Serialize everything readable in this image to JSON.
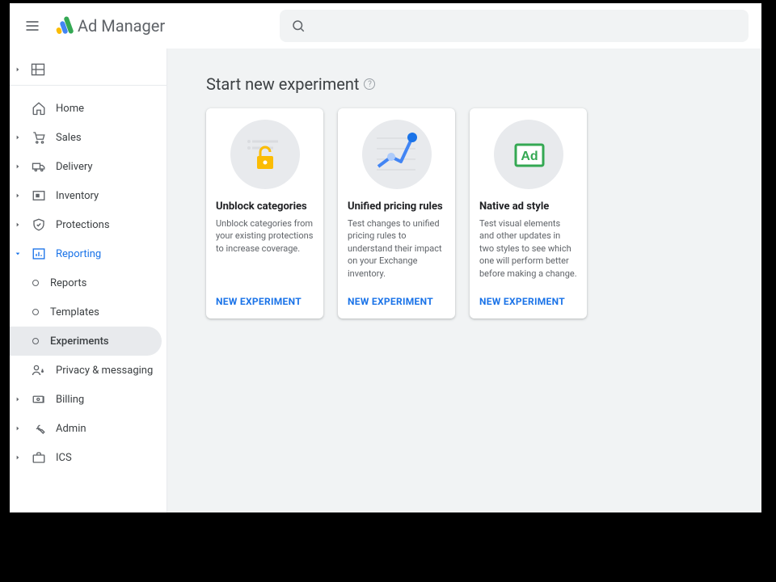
{
  "header": {
    "app_name": "Ad Manager",
    "search_placeholder": ""
  },
  "sidebar": {
    "items": [
      {
        "id": "home",
        "label": "Home",
        "expandable": false
      },
      {
        "id": "sales",
        "label": "Sales",
        "expandable": true
      },
      {
        "id": "delivery",
        "label": "Delivery",
        "expandable": true
      },
      {
        "id": "inventory",
        "label": "Inventory",
        "expandable": true
      },
      {
        "id": "protections",
        "label": "Protections",
        "expandable": true
      },
      {
        "id": "reporting",
        "label": "Reporting",
        "expandable": true,
        "active": true,
        "children": [
          {
            "id": "reports",
            "label": "Reports"
          },
          {
            "id": "templates",
            "label": "Templates"
          },
          {
            "id": "experiments",
            "label": "Experiments",
            "selected": true
          }
        ]
      },
      {
        "id": "privacy",
        "label": "Privacy & messaging",
        "expandable": false
      },
      {
        "id": "billing",
        "label": "Billing",
        "expandable": true
      },
      {
        "id": "admin",
        "label": "Admin",
        "expandable": true
      },
      {
        "id": "ics",
        "label": "ICS",
        "expandable": true
      }
    ]
  },
  "main": {
    "page_title": "Start new experiment",
    "cards": [
      {
        "id": "unblock",
        "title": "Unblock categories",
        "desc": "Unblock categories from your existing protections to increase coverage.",
        "cta": "NEW EXPERIMENT"
      },
      {
        "id": "upr",
        "title": "Unified pricing rules",
        "desc": "Test changes to unified pricing rules to understand their impact on your Exchange inventory.",
        "cta": "NEW EXPERIMENT"
      },
      {
        "id": "native",
        "title": "Native ad style",
        "desc": "Test visual elements and other updates in two styles to see which one will perform better before making a change.",
        "cta": "NEW EXPERIMENT"
      }
    ]
  }
}
